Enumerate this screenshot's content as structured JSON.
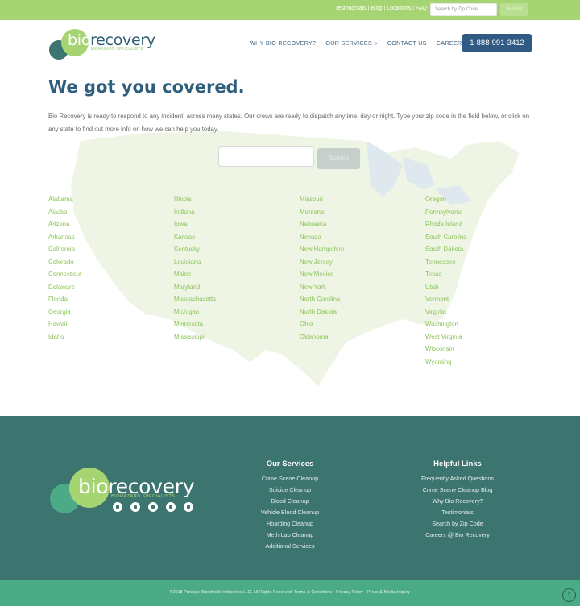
{
  "topbar": {
    "links": [
      "Testimonials",
      "Blog",
      "Locations",
      "FAQ"
    ],
    "separator": "|",
    "search_placeholder": "Search by Zip Code",
    "submit_label": "Submit"
  },
  "header": {
    "logo_bio": "bio",
    "logo_recovery": "recovery",
    "logo_tagline": "BIOHAZARD SPECIALISTS",
    "nav": [
      "WHY BIO RECOVERY?",
      "OUR SERVICES »",
      "CONTACT US",
      "CAREERS"
    ],
    "phone": "1-888-991-3412"
  },
  "main": {
    "title": "We got you covered.",
    "intro": "Bio Recovery is ready to respond to any incident, across many states. Our crews are ready to dispatch anytime: day or night. Type your zip code in the field below, or click on any state to find out more info on how we can help you today.",
    "zip_placeholder": "",
    "submit_label": "Submit"
  },
  "states": {
    "col1": [
      "Alabama",
      "Alaska",
      "Arizona",
      "Arkansas",
      "California",
      "Colorado",
      "Connecticut",
      "Delaware",
      "Florida",
      "Georgia",
      "Hawaii",
      "Idaho"
    ],
    "col2": [
      "Illinois",
      "Indiana",
      "Iowa",
      "Kansas",
      "Kentucky",
      "Louisiana",
      "Maine",
      "Maryland",
      "Massachusetts",
      "Michigan",
      "Minnesota",
      "Mississippi"
    ],
    "col3": [
      "Missouri",
      "Montana",
      "Nebraska",
      "Nevada",
      "New Hampshire",
      "New Jersey",
      "New Mexico",
      "New York",
      "North Carolina",
      "North Dakota",
      "Ohio",
      "Oklahoma"
    ],
    "col4": [
      "Oregon",
      "Pennsylvania",
      "Rhode Island",
      "South Carolina",
      "South Dakota",
      "Tennessee",
      "Texas",
      "Utah",
      "Vermont",
      "Virginia",
      "Washington",
      "West Virginia",
      "Wisconsin",
      "Wyoming"
    ]
  },
  "footer": {
    "logo_bio": "bio",
    "logo_recovery": "recovery",
    "logo_tagline": "BIOHAZARD SPECIALISTS",
    "socials": [
      "facebook-icon",
      "twitter-icon",
      "youtube-icon",
      "google-plus-icon",
      "instagram-icon"
    ],
    "services_title": "Our Services",
    "services": [
      "Crime Scene Cleanup",
      "Suicide Cleanup",
      "Blood Cleanup",
      "Vehicle Blood Cleanup",
      "Hoarding Cleanup",
      "Meth Lab Cleanup",
      "Additional Services"
    ],
    "links_title": "Helpful Links",
    "links": [
      "Frequently Asked Questions",
      "Crime Scene Cleanup Blog",
      "Why Bio Recovery?",
      "Testimonials",
      "Search by Zip Code",
      "Careers @ Bio Recovery"
    ],
    "copyright": "©2018 Prestige Worldwide Industries LLC. All Rights Reserved. Terms & Conditions · Privacy Policy · Press & Media Inquiry",
    "totop_icon": "chevron-up-icon"
  },
  "colors": {
    "topbar": "#a6d473",
    "brand_blue": "#2f5e7d",
    "state_link": "#8cc35a",
    "footer_bg": "#3c7470",
    "bottom_bar": "#4bab86"
  }
}
